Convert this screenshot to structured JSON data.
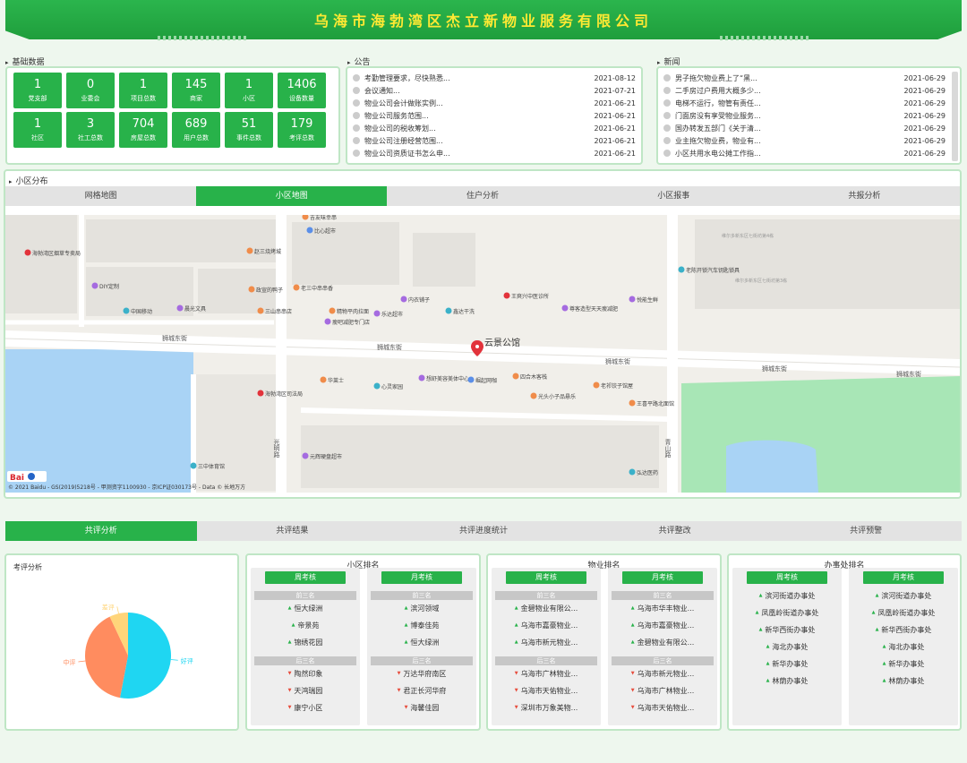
{
  "header": {
    "title": "乌海市海勃湾区杰立新物业服务有限公司"
  },
  "basic": {
    "label": "基础数据",
    "stats": [
      {
        "value": "1",
        "label": "党支部"
      },
      {
        "value": "0",
        "label": "业委会"
      },
      {
        "value": "1",
        "label": "项目总数"
      },
      {
        "value": "145",
        "label": "商家"
      },
      {
        "value": "1",
        "label": "小区"
      },
      {
        "value": "1406",
        "label": "设备数量"
      },
      {
        "value": "1",
        "label": "社区"
      },
      {
        "value": "3",
        "label": "社工总数"
      },
      {
        "value": "704",
        "label": "房屋总数"
      },
      {
        "value": "689",
        "label": "用户总数"
      },
      {
        "value": "51",
        "label": "事件总数"
      },
      {
        "value": "179",
        "label": "考评总数"
      }
    ]
  },
  "notice": {
    "label": "公告",
    "items": [
      {
        "title": "考勤管理要求，尽快熟悉...",
        "date": "2021-08-12"
      },
      {
        "title": "会议通知...",
        "date": "2021-07-21"
      },
      {
        "title": "物业公司会计做账实例...",
        "date": "2021-06-21"
      },
      {
        "title": "物业公司服务范围...",
        "date": "2021-06-21"
      },
      {
        "title": "物业公司的税收筹划...",
        "date": "2021-06-21"
      },
      {
        "title": "物业公司注册经营范围...",
        "date": "2021-06-21"
      },
      {
        "title": "物业公司资质证书怎么申...",
        "date": "2021-06-21"
      }
    ]
  },
  "news": {
    "label": "新闻",
    "items": [
      {
        "title": "男子拖欠物业费上了“黑...",
        "date": "2021-06-29"
      },
      {
        "title": "二手房过户费用大概多少...",
        "date": "2021-06-29"
      },
      {
        "title": "电梯不运行，物管有责任...",
        "date": "2021-06-29"
      },
      {
        "title": "门面房没有享受物业服务...",
        "date": "2021-06-29"
      },
      {
        "title": "国办转发五部门《关于清...",
        "date": "2021-06-29"
      },
      {
        "title": "业主拖欠物业费，物业有...",
        "date": "2021-06-29"
      },
      {
        "title": "小区共用水电公摊工作指...",
        "date": "2021-06-29"
      }
    ]
  },
  "district": {
    "label": "小区分布",
    "tabs": [
      "网格地图",
      "小区地图",
      "住户分析",
      "小区报事",
      "共报分析"
    ],
    "active": 1
  },
  "map": {
    "roads": [
      "狮城东街",
      "狮城东街",
      "狮城东街",
      "狮城东街",
      "狮城东街",
      "光明路",
      "青山路"
    ],
    "pois": [
      "吉友味幸串",
      "比心超市",
      "赵三烧烤城",
      "海勃湾区烟草专卖局",
      "DIY定制",
      "中国移动",
      "晨光文具",
      "政宣的鸭子",
      "老三中串串香",
      "三山串串店",
      "精物平肉拉面",
      "内衣铺子",
      "乐达超市",
      "鑫达干洗",
      "王爽兴中医诊所",
      "尊客造型天天瘦减肥",
      "悦能生鲜",
      "老陈开锁汽车钥匙锁具",
      "瘦吧减肥专门店",
      "华莱士",
      "心灵家园",
      "想舒美容美体中心",
      "崛起网咖",
      "四合木客栈",
      "光头小子品悬乐",
      "老祁饺子馆屋",
      "王喜平路北面馆",
      "海勃湾区司法局",
      "三中体育馆",
      "元辉硬盘超市",
      "弘达医药",
      "云景公馆",
      "维尔多新东区七街坊第4栋",
      "维尔多新东区七街坊第3栋"
    ],
    "pin": "云景公馆",
    "copyright": "© 2021 Baidu - GS(2019)5218号 - 甲测资字1100930 - 京ICP证030173号 - Data © 长地万方"
  },
  "bottom_tabs": {
    "tabs": [
      "共评分析",
      "共评结果",
      "共评进度统计",
      "共评整改",
      "共评预警"
    ],
    "active": 0
  },
  "pie": {
    "title": "考评分析",
    "chart_data": {
      "type": "pie",
      "labels": [
        "好评",
        "中评",
        "差评"
      ],
      "values": [
        53,
        40,
        7
      ],
      "colors": [
        "#1fd6f2",
        "#ff8c5f",
        "#ffd57a"
      ]
    }
  },
  "rank_sections": [
    {
      "title": "小区排名",
      "week": "周考核",
      "month": "月考核",
      "top": "前三名",
      "bottom": "后三名",
      "week_top": [
        "恒大绿洲",
        "帝景苑",
        "锦绣花园"
      ],
      "week_bottom": [
        "陶然印象",
        "天鸿瑞园",
        "康宁小区"
      ],
      "month_top": [
        "滨河领域",
        "博泰佳苑",
        "恒大绿洲"
      ],
      "month_bottom": [
        "万达华府南区",
        "君正长河华府",
        "海馨佳园"
      ]
    },
    {
      "title": "物业排名",
      "week": "周考核",
      "month": "月考核",
      "top": "前三名",
      "bottom": "后三名",
      "week_top": [
        "金碧物业有限公...",
        "乌海市嘉豪物业...",
        "乌海市新元物业..."
      ],
      "week_bottom": [
        "乌海市广林物业...",
        "乌海市天佑物业...",
        "深圳市万象美物..."
      ],
      "month_top": [
        "乌海市华丰物业...",
        "乌海市嘉豪物业...",
        "金碧物业有限公..."
      ],
      "month_bottom": [
        "乌海市新元物业...",
        "乌海市广林物业...",
        "乌海市天佑物业..."
      ]
    },
    {
      "title": "办事处排名",
      "week": "周考核",
      "month": "月考核",
      "week_list": [
        "滨河街道办事处",
        "凤凰岭街道办事处",
        "新华西街办事处",
        "海北办事处",
        "新华办事处",
        "林荫办事处"
      ],
      "month_list": [
        "滨河街道办事处",
        "凤凰岭街道办事处",
        "新华西街办事处",
        "海北办事处",
        "新华办事处",
        "林荫办事处"
      ]
    }
  ]
}
